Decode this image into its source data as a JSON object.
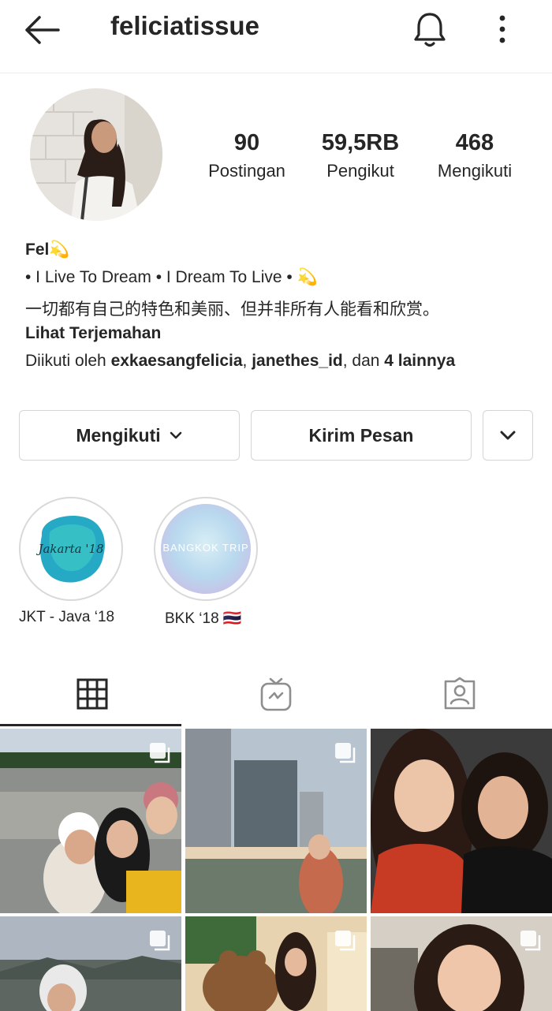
{
  "header": {
    "username": "feliciatissue",
    "icons": [
      "back-arrow-icon",
      "bell-icon",
      "more-vertical-icon"
    ]
  },
  "stats": [
    {
      "value": "90",
      "label": "Postingan"
    },
    {
      "value": "59,5RB",
      "label": "Pengikut"
    },
    {
      "value": "468",
      "label": "Mengikuti"
    }
  ],
  "bio": {
    "name": "Fel💫",
    "line1": "• I Live To Dream • I Dream To Live • 💫",
    "line2": "一切都有自己的特色和美丽、但并非所有人能看和欣赏。",
    "translate": "Lihat Terjemahan",
    "followed_prefix": "Diikuti oleh ",
    "followed_user1": "exkaesangfelicia",
    "followed_sep": ", ",
    "followed_user2": "janethes_id",
    "followed_mid": ", dan ",
    "followed_more": "4 lainnya"
  },
  "buttons": {
    "following": "Mengikuti",
    "message": "Kirim Pesan"
  },
  "highlights": [
    {
      "label": "JKT - Java ‘18",
      "cover_text": "Jakarta '18",
      "color": "#2fb7c9"
    },
    {
      "label": "BKK ‘18 🇹🇭",
      "cover_text": "BANGKOK TRIP",
      "color": "#b9d8f0"
    }
  ],
  "tabs": [
    "grid-icon",
    "igtv-icon",
    "tagged-icon"
  ],
  "colors": {
    "text": "#262626",
    "border": "#d5d5d5",
    "divider": "#ececec"
  }
}
